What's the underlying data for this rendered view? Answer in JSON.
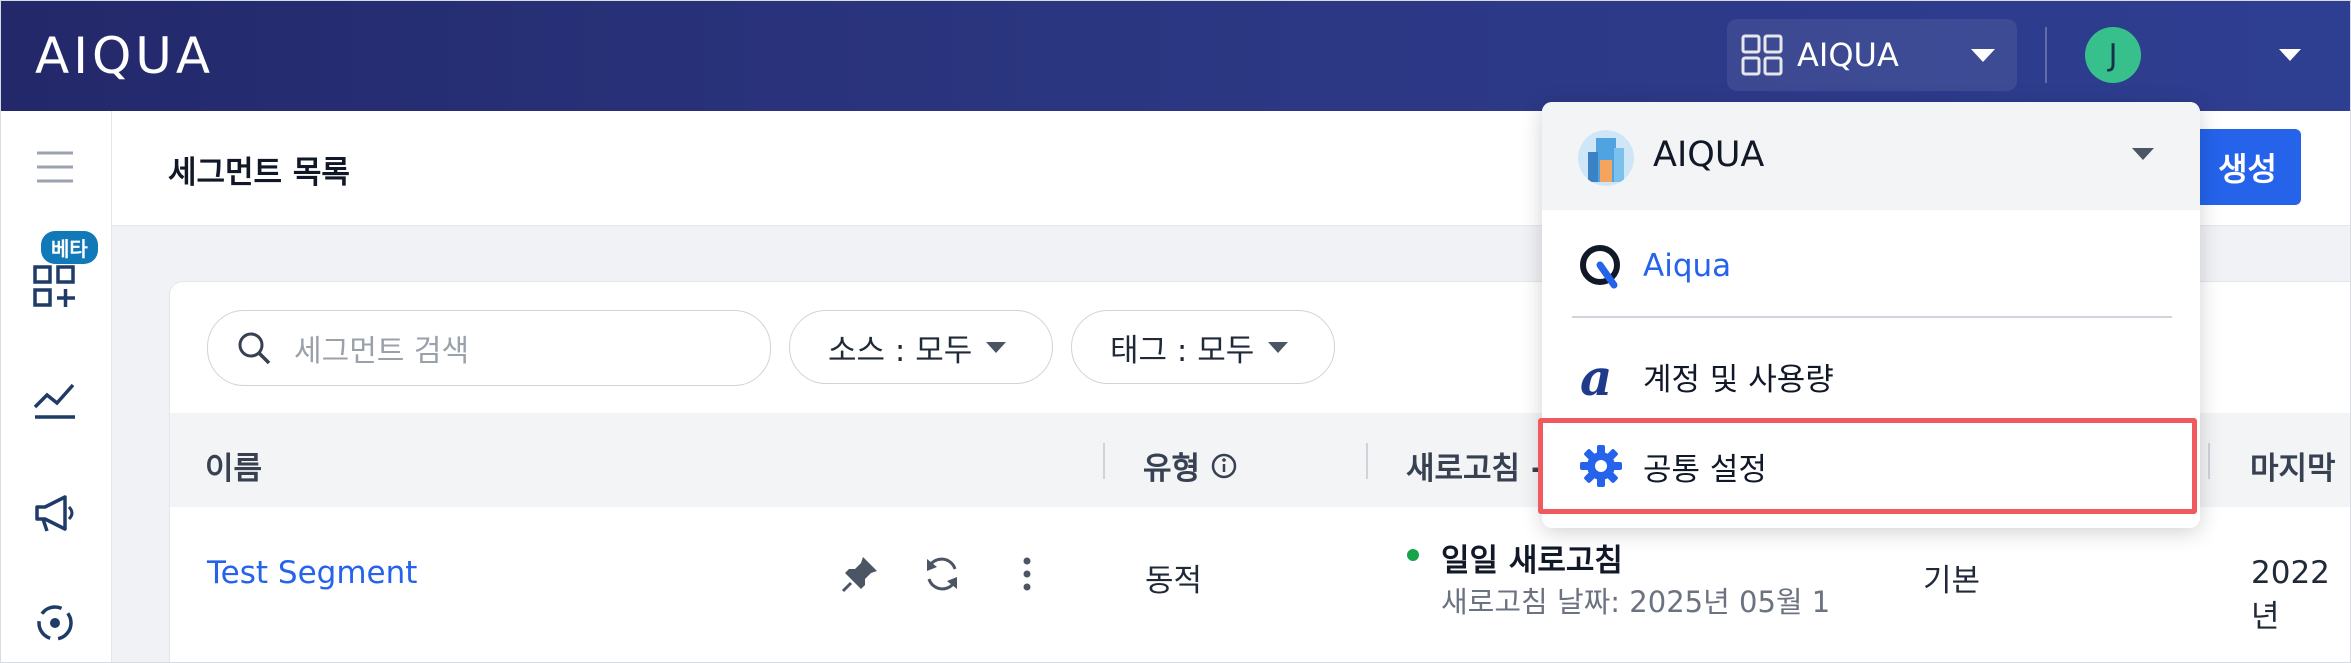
{
  "header": {
    "logo": "AIQUA",
    "workspace_switcher_label": "AIQUA",
    "user_initial": "J"
  },
  "sidebar": {
    "beta_badge": "베타",
    "icons": [
      "menu-icon",
      "dashboard-add-icon",
      "analytics-chart-icon",
      "megaphone-icon",
      "cycle-icon"
    ]
  },
  "page": {
    "title": "세그먼트 목록",
    "create_button": "생성"
  },
  "filters": {
    "search_placeholder": "세그먼트 검색",
    "source_filter": "소스 : 모두",
    "tag_filter": "태그 : 모두"
  },
  "table": {
    "columns": [
      "이름",
      "유형",
      "새로고침 -",
      "마지막"
    ],
    "rows": [
      {
        "name": "Test Segment",
        "type": "동적",
        "refresh_title": "일일 새로고침",
        "refresh_sub": "새로고침 날짜: 2025년 05월 1",
        "extra": "기본",
        "last": "2022년"
      }
    ]
  },
  "dropdown": {
    "workspace": "AIQUA",
    "items": [
      {
        "label": "Aiqua",
        "icon": "aiqua-q-icon",
        "color": "#2563eb"
      },
      {
        "label": "계정 및 사용량",
        "icon": "alpha-a-icon"
      },
      {
        "label": "공통 설정",
        "icon": "gear-icon",
        "highlighted": true
      }
    ]
  },
  "colors": {
    "topbar": "#2b3680",
    "accent": "#2563eb",
    "highlight": "#f0595e",
    "avatar": "#38c08c",
    "status_dot": "#16a34a"
  }
}
